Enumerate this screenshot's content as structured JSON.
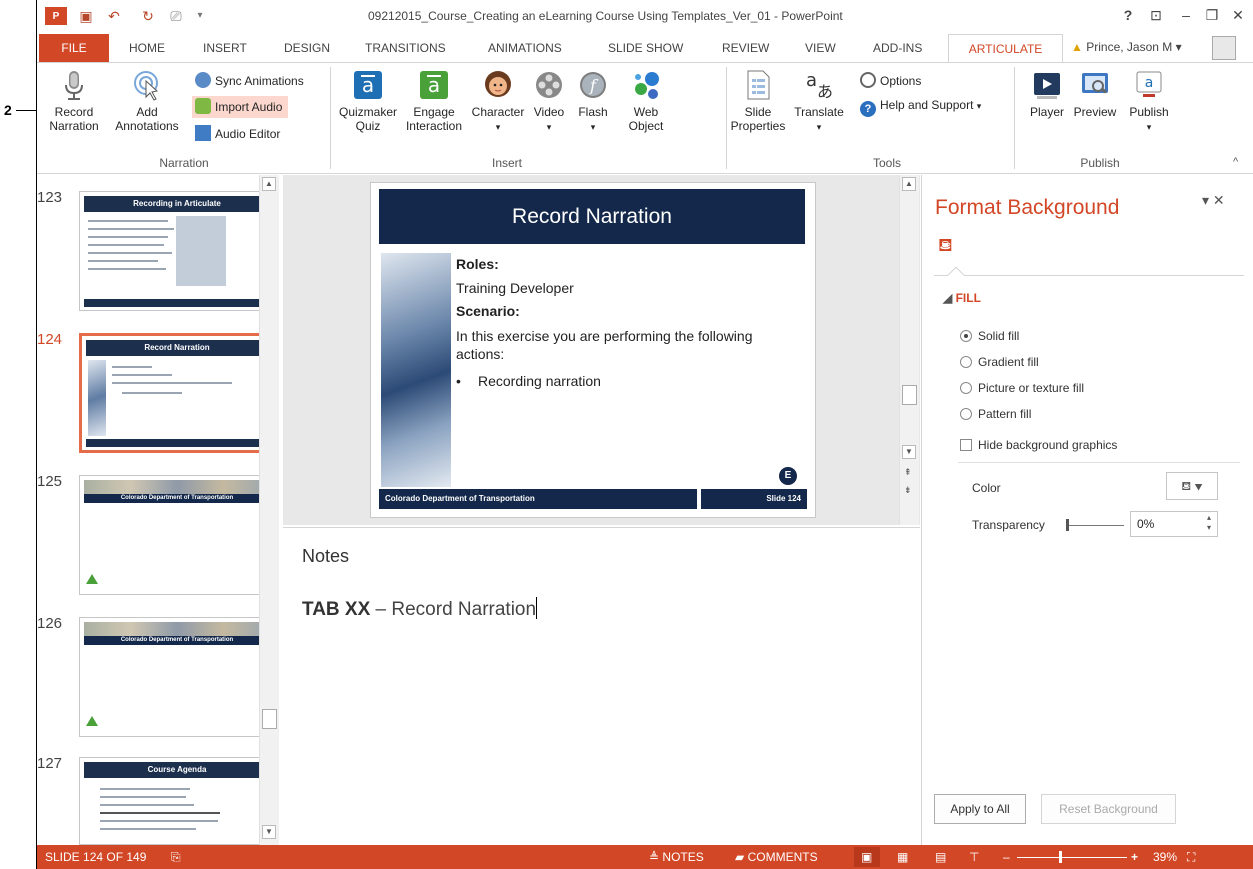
{
  "window": {
    "title": "09212015_Course_Creating an eLearning Course Using Templates_Ver_01 - PowerPoint"
  },
  "tabs": [
    "FILE",
    "HOME",
    "INSERT",
    "DESIGN",
    "TRANSITIONS",
    "ANIMATIONS",
    "SLIDE SHOW",
    "REVIEW",
    "VIEW",
    "ADD-INS",
    "ARTICULATE"
  ],
  "user": {
    "name": "Prince, Jason M"
  },
  "annotation": "2",
  "ribbon": {
    "narration": {
      "record": "Record\nNarration",
      "add_annotations": "Add\nAnnotations",
      "sync_animations": "Sync Animations",
      "import_audio": "Import Audio",
      "audio_editor": "Audio Editor",
      "label": "Narration"
    },
    "insert": {
      "quizmaker": "Quizmaker\nQuiz",
      "engage": "Engage\nInteraction",
      "character": "Character",
      "video": "Video",
      "flash": "Flash",
      "web_object": "Web\nObject",
      "label": "Insert"
    },
    "tools": {
      "slide_properties": "Slide\nProperties",
      "translate": "Translate",
      "options": "Options",
      "help": "Help and Support",
      "label": "Tools"
    },
    "publish": {
      "player": "Player",
      "preview": "Preview",
      "publish": "Publish",
      "label": "Publish"
    }
  },
  "thumbnails": [
    {
      "num": "123",
      "title": "Recording in Articulate"
    },
    {
      "num": "124",
      "title": "Record Narration"
    },
    {
      "num": "125",
      "title": "Colorado Department of Transportation"
    },
    {
      "num": "126",
      "title": "Colorado Department of Transportation"
    },
    {
      "num": "127",
      "title": "Course Agenda"
    }
  ],
  "slide": {
    "title": "Record Narration",
    "roles_label": "Roles:",
    "roles_value": "Training Developer",
    "scenario_label": "Scenario:",
    "scenario_text_1": "In this exercise you are performing the following",
    "scenario_text_2": "actions:",
    "bullet": "Recording narration",
    "footer_left": "Colorado Department of Transportation",
    "footer_right": "Slide 124",
    "badge": "E"
  },
  "notes": {
    "title": "Notes",
    "bold": "TAB XX",
    "text": " – Record Narration"
  },
  "format_pane": {
    "title": "Format Background",
    "fill_header": "FILL",
    "options": [
      "Solid fill",
      "Gradient fill",
      "Picture or texture fill",
      "Pattern fill"
    ],
    "selected_option": "Solid fill",
    "hide_bg": "Hide background graphics",
    "color_label": "Color",
    "transparency_label": "Transparency",
    "transparency_value": "0%",
    "apply_all": "Apply to All",
    "reset": "Reset Background"
  },
  "status": {
    "slide": "SLIDE 124 OF 149",
    "notes": "NOTES",
    "comments": "COMMENTS",
    "zoom": "39%"
  },
  "colors": {
    "accent": "#d24726",
    "slide_navy": "#13284a"
  }
}
